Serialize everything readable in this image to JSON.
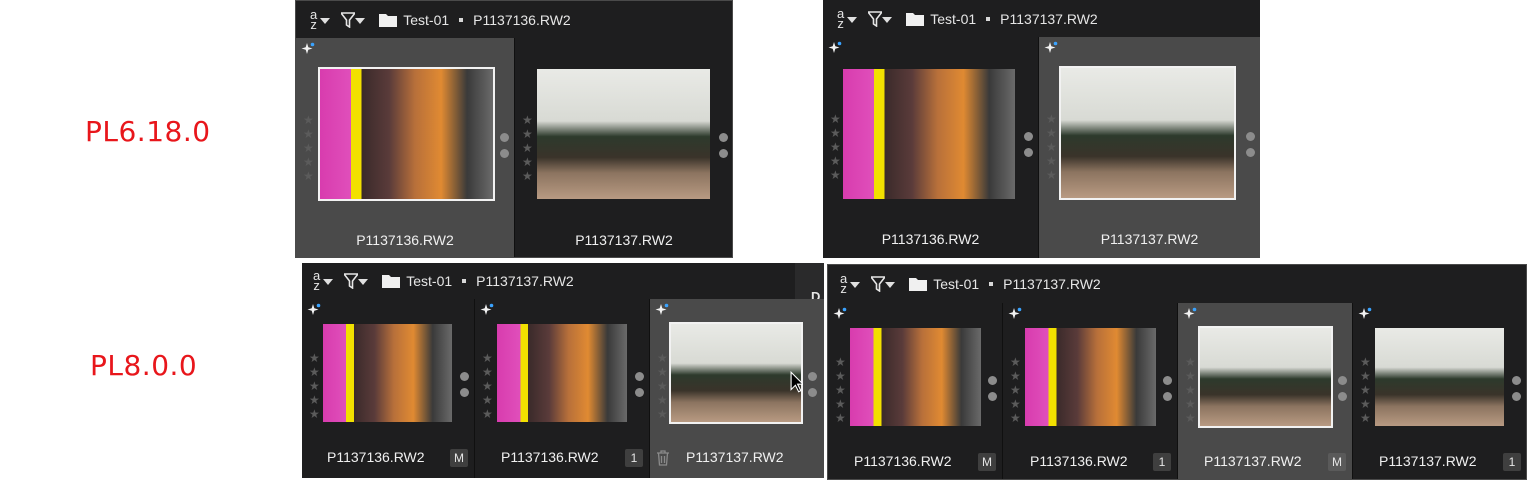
{
  "labels": {
    "v1": "PL6.18.0",
    "v2": "PL8.0.0"
  },
  "panels": [
    {
      "sort": {
        "a": "a",
        "z": "z"
      },
      "folder": "Test-01",
      "file": "P1137136.RW2",
      "cells": [
        {
          "name": "P1137136.RW2",
          "photo": "skull",
          "selected": true
        },
        {
          "name": "P1137137.RW2",
          "photo": "street",
          "selected": false
        }
      ]
    },
    {
      "sort": {
        "a": "a",
        "z": "z"
      },
      "folder": "Test-01",
      "file": "P1137137.RW2",
      "cells": [
        {
          "name": "P1137136.RW2",
          "photo": "skull",
          "selected": false
        },
        {
          "name": "P1137137.RW2",
          "photo": "street",
          "selected": true
        }
      ]
    },
    {
      "sort": {
        "a": "a",
        "z": "z"
      },
      "folder": "Test-01",
      "file": "P1137137.RW2",
      "side_text": "D",
      "cells": [
        {
          "name": "P1137136.RW2",
          "photo": "skull",
          "badge": "M"
        },
        {
          "name": "P1137136.RW2",
          "photo": "skull",
          "badge": "1"
        },
        {
          "name": "P1137137.RW2",
          "photo": "street",
          "selected": true,
          "trash": true
        }
      ]
    },
    {
      "sort": {
        "a": "a",
        "z": "z"
      },
      "folder": "Test-01",
      "file": "P1137137.RW2",
      "cells": [
        {
          "name": "P1137136.RW2",
          "photo": "skull",
          "badge": "M"
        },
        {
          "name": "P1137136.RW2",
          "photo": "skull",
          "badge": "1"
        },
        {
          "name": "P1137137.RW2",
          "photo": "street",
          "selected": true,
          "badge": "M"
        },
        {
          "name": "P1137137.RW2",
          "photo": "street",
          "badge": "1"
        }
      ]
    }
  ]
}
